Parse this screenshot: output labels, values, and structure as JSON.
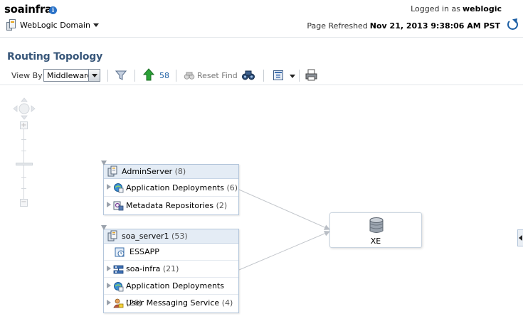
{
  "header": {
    "app_title": "soainfra",
    "logged_in_label": "Logged in as",
    "username": "weblogic",
    "domain_menu_label": "WebLogic Domain",
    "refreshed_label": "Page Refreshed",
    "refreshed_time": "Nov 21, 2013 9:38:06 AM PST"
  },
  "page": {
    "title": "Routing Topology"
  },
  "toolbar": {
    "view_by_label": "View By",
    "view_by_value": "Middleware",
    "up_count": "58",
    "reset_find_label": "Reset Find"
  },
  "topology": {
    "admin_server": {
      "name": "AdminServer",
      "count": "(8)",
      "rows": [
        {
          "label": "Application Deployments",
          "count": "(6)"
        },
        {
          "label": "Metadata Repositories",
          "count": "(2)"
        }
      ]
    },
    "soa_server": {
      "name": "soa_server1",
      "count": "(53)",
      "rows": [
        {
          "label": "ESSAPP",
          "count": ""
        },
        {
          "label": "soa-infra",
          "count": "(21)"
        },
        {
          "label": "Application Deployments",
          "count": "(26)"
        },
        {
          "label": "User Messaging Service",
          "count": "(4)"
        }
      ]
    },
    "database": {
      "name": "XE"
    }
  }
}
